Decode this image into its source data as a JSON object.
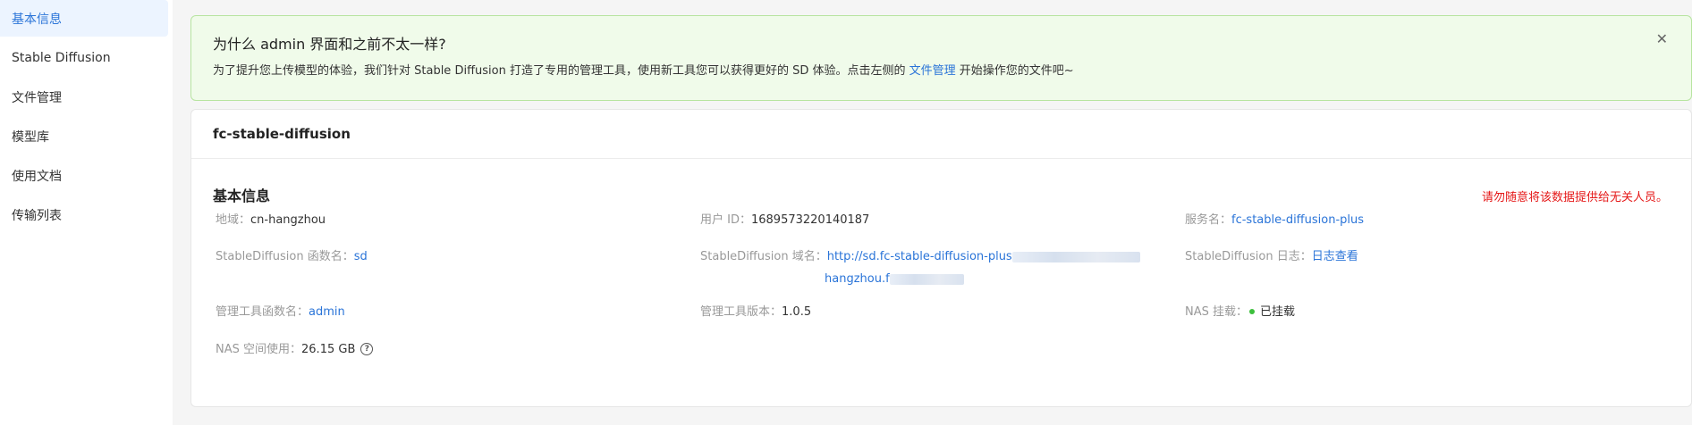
{
  "sidebar": {
    "items": [
      {
        "label": "基本信息"
      },
      {
        "label": "Stable Diffusion"
      },
      {
        "label": "文件管理"
      },
      {
        "label": "模型库"
      },
      {
        "label": "使用文档"
      },
      {
        "label": "传输列表"
      }
    ]
  },
  "alert": {
    "title": "为什么 admin 界面和之前不太一样?",
    "desc_prefix": "为了提升您上传模型的体验，我们针对 Stable Diffusion 打造了专用的管理工具，使用新工具您可以获得更好的 SD 体验。点击左侧的 ",
    "desc_link": "文件管理",
    "desc_suffix": " 开始操作您的文件吧~",
    "close_icon": "close-icon"
  },
  "card": {
    "header": "fc-stable-diffusion",
    "section_title": "基本信息",
    "warning": "请勿随意将该数据提供给无关人员。",
    "fields": {
      "region": {
        "label": "地域：",
        "value": "cn-hangzhou"
      },
      "user_id": {
        "label": "用户 ID：",
        "value": "1689573220140187"
      },
      "service_name": {
        "label": "服务名：",
        "value": "fc-stable-diffusion-plus"
      },
      "sd_func": {
        "label": "StableDiffusion 函数名：",
        "value": "sd"
      },
      "sd_domain": {
        "label": "StableDiffusion 域名：",
        "value_line1": "http://sd.fc-stable-diffusion-plus",
        "value_line2": "hangzhou.f"
      },
      "sd_log": {
        "label": "StableDiffusion 日志：",
        "value": "日志查看"
      },
      "admin_func": {
        "label": "管理工具函数名：",
        "value": "admin"
      },
      "admin_version": {
        "label": "管理工具版本：",
        "value": "1.0.5"
      },
      "nas_mount": {
        "label": "NAS 挂载：",
        "value": "已挂载",
        "status_color": "#3cbf3c"
      },
      "nas_usage": {
        "label": "NAS 空间使用：",
        "value": "26.15 GB",
        "help_icon": "question-circle-icon"
      }
    }
  },
  "colors": {
    "accent": "#2a74d8",
    "warning": "#e51919",
    "alert_bg": "#f0fbea"
  }
}
